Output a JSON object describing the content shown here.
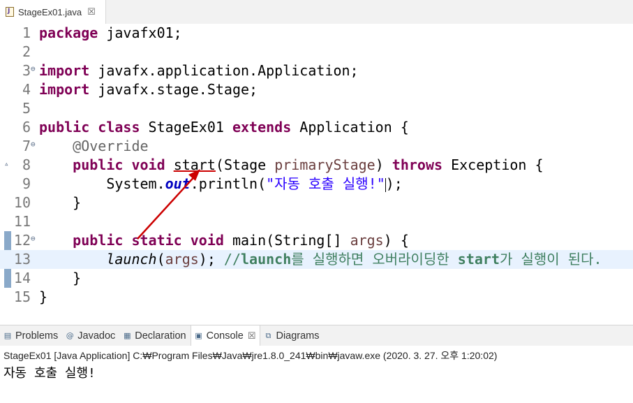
{
  "editor_tab": {
    "label": "StageEx01.java",
    "close": "☒"
  },
  "lines": [
    {
      "n": "1",
      "code": [
        [
          "kw",
          "package"
        ],
        [
          "plain",
          " javafx01;"
        ]
      ]
    },
    {
      "n": "2",
      "code": []
    },
    {
      "n": "3",
      "fold": "⊖",
      "code": [
        [
          "kw",
          "import"
        ],
        [
          "plain",
          " javafx.application.Application;"
        ]
      ]
    },
    {
      "n": "4",
      "code": [
        [
          "kw",
          "import"
        ],
        [
          "plain",
          " javafx.stage.Stage;"
        ]
      ]
    },
    {
      "n": "5",
      "code": []
    },
    {
      "n": "6",
      "code": [
        [
          "kw",
          "public"
        ],
        [
          "plain",
          " "
        ],
        [
          "kw",
          "class"
        ],
        [
          "plain",
          " StageEx01 "
        ],
        [
          "kw",
          "extends"
        ],
        [
          "plain",
          " Application {"
        ]
      ]
    },
    {
      "n": "7",
      "fold": "⊖",
      "code": [
        [
          "plain",
          "    "
        ],
        [
          "anno",
          "@Override"
        ]
      ]
    },
    {
      "n": "8",
      "override": "▵",
      "code": [
        [
          "plain",
          "    "
        ],
        [
          "kw",
          "public"
        ],
        [
          "plain",
          " "
        ],
        [
          "kw",
          "void"
        ],
        [
          "plain",
          " "
        ],
        [
          "ul",
          "start"
        ],
        [
          "plain",
          "(Stage "
        ],
        [
          "param",
          "primaryStage"
        ],
        [
          "plain",
          ") "
        ],
        [
          "kw",
          "throws"
        ],
        [
          "plain",
          " Exception {"
        ]
      ]
    },
    {
      "n": "9",
      "code": [
        [
          "plain",
          "        System."
        ],
        [
          "static-field",
          "out"
        ],
        [
          "plain",
          ".println("
        ],
        [
          "str",
          "\"자동 호출 실행!\""
        ],
        [
          "caret",
          ""
        ],
        [
          "plain",
          ");"
        ]
      ]
    },
    {
      "n": "10",
      "code": [
        [
          "plain",
          "    }"
        ]
      ]
    },
    {
      "n": "11",
      "code": []
    },
    {
      "n": "12",
      "fold": "⊖",
      "code": [
        [
          "plain",
          "    "
        ],
        [
          "kw",
          "public"
        ],
        [
          "plain",
          " "
        ],
        [
          "kw",
          "static"
        ],
        [
          "plain",
          " "
        ],
        [
          "kw",
          "void"
        ],
        [
          "plain",
          " main(String[] "
        ],
        [
          "param",
          "args"
        ],
        [
          "plain",
          ") {"
        ]
      ]
    },
    {
      "n": "13",
      "current": true,
      "code": [
        [
          "plain",
          "        "
        ],
        [
          "static-call",
          "launch"
        ],
        [
          "plain",
          "("
        ],
        [
          "param",
          "args"
        ],
        [
          "plain",
          "); "
        ],
        [
          "cmt",
          "//"
        ],
        [
          "cmt-b",
          "launch"
        ],
        [
          "cmt",
          "를 실행하면 오버라이딩한 "
        ],
        [
          "cmt-b",
          "start"
        ],
        [
          "cmt",
          "가 실행이 된다."
        ]
      ]
    },
    {
      "n": "14",
      "code": [
        [
          "plain",
          "    }"
        ]
      ]
    },
    {
      "n": "15",
      "code": [
        [
          "plain",
          "}"
        ]
      ]
    }
  ],
  "views": {
    "tabs": [
      {
        "label": "Problems",
        "icon": "problems-icon",
        "glyph": "▤",
        "active": false
      },
      {
        "label": "Javadoc",
        "icon": "javadoc-icon",
        "glyph": "@",
        "active": false
      },
      {
        "label": "Declaration",
        "icon": "declaration-icon",
        "glyph": "▦",
        "active": false
      },
      {
        "label": "Console",
        "icon": "console-icon",
        "glyph": "▣",
        "active": true,
        "close": "☒"
      },
      {
        "label": "Diagrams",
        "icon": "diagrams-icon",
        "glyph": "⧉",
        "active": false
      }
    ]
  },
  "console": {
    "description": "StageEx01 [Java Application] C:₩Program Files₩Java₩jre1.8.0_241₩bin₩javaw.exe (2020. 3. 27. 오후 1:20:02)",
    "output": "자동 호출 실행!"
  },
  "colors": {
    "keyword": "#7f0055",
    "string": "#2a00ff",
    "comment": "#3f7f5f",
    "annotation_arrow": "#cc0000"
  }
}
